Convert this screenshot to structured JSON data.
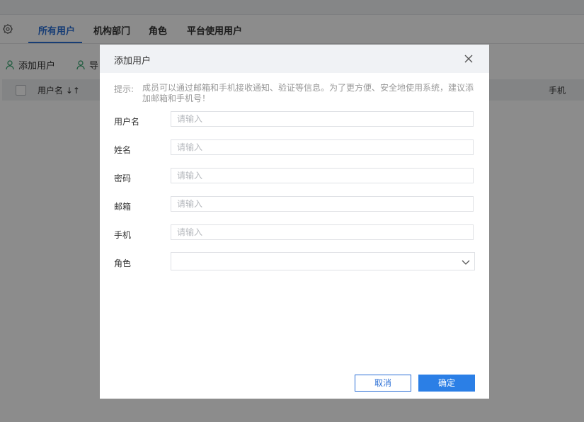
{
  "tabs": [
    {
      "label": "所有用户",
      "active": true
    },
    {
      "label": "机构部门"
    },
    {
      "label": "角色"
    },
    {
      "label": "平台使用用户"
    }
  ],
  "toolbar": {
    "add_user_label": "添加用户",
    "import_label": "导"
  },
  "table": {
    "columns": [
      "用户名 ↓↑",
      "手机"
    ]
  },
  "dialog": {
    "title": "添加用户",
    "hint_label": "提示:",
    "hint_text": "成员可以通过邮箱和手机接收通知、验证等信息。为了更方便、安全地使用系统，建议添加邮箱和手机号！",
    "fields": [
      {
        "label": "用户名",
        "placeholder": "请输入",
        "value": ""
      },
      {
        "label": "姓名",
        "placeholder": "请输入",
        "value": ""
      },
      {
        "label": "密码",
        "placeholder": "请输入",
        "value": ""
      },
      {
        "label": "邮箱",
        "placeholder": "请输入",
        "value": ""
      },
      {
        "label": "手机",
        "placeholder": "请输入",
        "value": ""
      }
    ],
    "role_label": "角色",
    "role_value": "",
    "cancel_label": "取消",
    "ok_label": "确定"
  },
  "colors": {
    "accent": "#2b6fd6",
    "primary_button": "#2b7fe6",
    "overlay": "rgba(0,0,0,0.45)"
  },
  "icons": [
    "gear-icon",
    "user-add-icon",
    "import-icon",
    "sort-icon",
    "close-icon",
    "chevron-down-icon"
  ]
}
